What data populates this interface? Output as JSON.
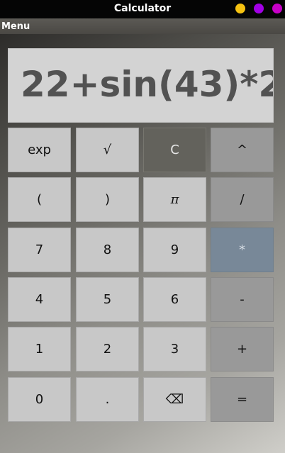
{
  "window": {
    "title": "Calculator",
    "controls": [
      {
        "name": "minimize",
        "color": "#f5c211"
      },
      {
        "name": "maximize",
        "color": "#a200e5"
      },
      {
        "name": "close",
        "color": "#c800c8"
      }
    ]
  },
  "menu": {
    "label": "Menu"
  },
  "display": {
    "expression": "22+sin(43)*2"
  },
  "keys": {
    "exp": "exp",
    "sqrt": "√",
    "clear": "C",
    "power": "^",
    "lparen": "(",
    "rparen": ")",
    "pi": "π",
    "divide": "/",
    "seven": "7",
    "eight": "8",
    "nine": "9",
    "multiply": "*",
    "four": "4",
    "five": "5",
    "six": "6",
    "minus": "-",
    "one": "1",
    "two": "2",
    "three": "3",
    "plus": "+",
    "zero": "0",
    "dot": ".",
    "backspace": "⌫",
    "equals": "="
  }
}
